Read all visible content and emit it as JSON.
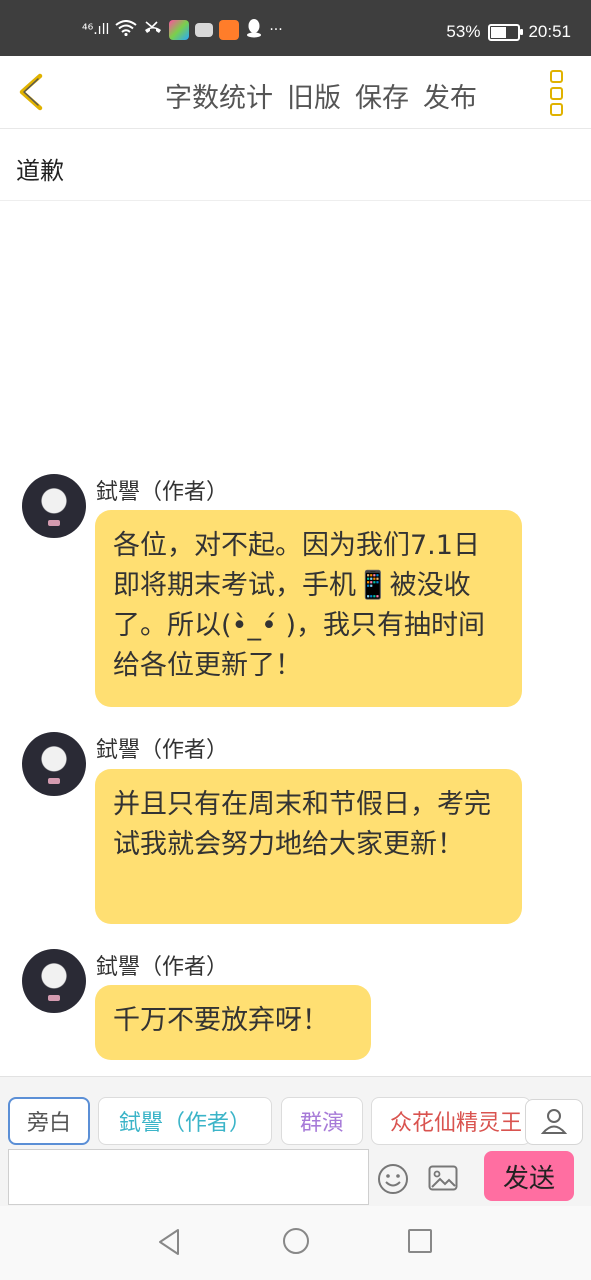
{
  "status_bar": {
    "network": "⁴⁶.ıll",
    "battery_percent": "53%",
    "battery_level": 0.53,
    "time": "20:51"
  },
  "toolbar": {
    "back_icon": "chevron-left-icon",
    "links": [
      "字数统计",
      "旧版",
      "保存",
      "发布"
    ],
    "more_icon": "more-vertical-icon",
    "accent": "#e0b200"
  },
  "chapter": {
    "title": "道歉"
  },
  "messages": [
    {
      "author": "鉽譻（作者）",
      "text": "各位，对不起。因为我们7.1日即将期末考试，手机📱被没收了。所以(•̀_•́ )，我只有抽时间给各位更新了！"
    },
    {
      "author": "鉽譻（作者）",
      "text": "并且只有在周末和节假日，考完试我就会努力地给大家更新！"
    },
    {
      "author": "鉽譻（作者）",
      "text": "千万不要放弃呀！"
    }
  ],
  "bubble_color": "#ffdf72",
  "roles": [
    {
      "label": "旁白",
      "color": "#555555"
    },
    {
      "label": "鉽譻（作者）",
      "color": "#3bb4c8"
    },
    {
      "label": "群演",
      "color": "#a77bd8"
    },
    {
      "label": "众花仙精灵王",
      "color": "#d9534f"
    }
  ],
  "composer": {
    "placeholder": "",
    "send_label": "发送",
    "send_color": "#ff6ea1"
  }
}
